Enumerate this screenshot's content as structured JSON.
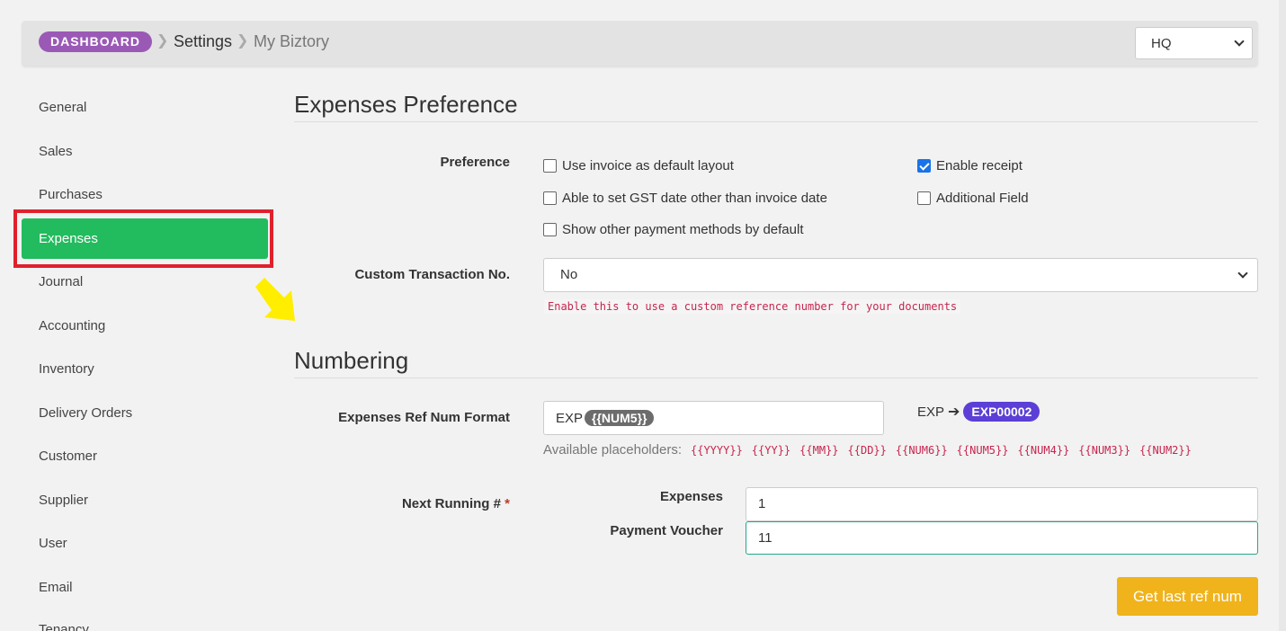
{
  "breadcrumb": {
    "dashboard": "DASHBOARD",
    "settings": "Settings",
    "company": "My Biztory"
  },
  "branch_select": {
    "value": "HQ"
  },
  "sidebar": {
    "items": [
      {
        "label": "General"
      },
      {
        "label": "Sales"
      },
      {
        "label": "Purchases"
      },
      {
        "label": "Expenses",
        "active": true
      },
      {
        "label": "Journal"
      },
      {
        "label": "Accounting"
      },
      {
        "label": "Inventory"
      },
      {
        "label": "Delivery Orders"
      },
      {
        "label": "Customer"
      },
      {
        "label": "Supplier"
      },
      {
        "label": "User"
      },
      {
        "label": "Email"
      },
      {
        "label": "Tenancy"
      }
    ]
  },
  "expenses_preference": {
    "title": "Expenses Preference",
    "preference_label": "Preference",
    "options": [
      {
        "label": "Use invoice as default layout",
        "checked": false
      },
      {
        "label": "Enable receipt",
        "checked": true
      },
      {
        "label": "Able to set GST date other than invoice date",
        "checked": false
      },
      {
        "label": "Additional Field",
        "checked": false
      },
      {
        "label": "Show other payment methods by default",
        "checked": false
      }
    ],
    "custom_txn_label": "Custom Transaction No.",
    "custom_txn_value": "No",
    "custom_txn_hint": "Enable this to use a custom reference number for your documents"
  },
  "numbering": {
    "title": "Numbering",
    "ref_format_label": "Expenses Ref Num Format",
    "ref_prefix": "EXP",
    "ref_placeholder_token": "{{NUM5}}",
    "preview_prefix": "EXP",
    "preview_arrow": "➔",
    "preview_result": "EXP00002",
    "available_label": "Available placeholders:",
    "placeholders": [
      "{{YYYY}}",
      "{{YY}}",
      "{{MM}}",
      "{{DD}}",
      "{{NUM6}}",
      "{{NUM5}}",
      "{{NUM4}}",
      "{{NUM3}}",
      "{{NUM2}}"
    ],
    "next_running_label": "Next Running #",
    "required_mark": "*",
    "expenses_label": "Expenses",
    "expenses_value": "1",
    "payment_voucher_label": "Payment Voucher",
    "payment_voucher_value": "11",
    "get_last_button": "Get last ref num"
  },
  "colors": {
    "active_sidebar": "#22bb5e",
    "highlight": "#e0202c",
    "annotation_arrow": "#ffee00",
    "dashboard_pill": "#9b59b6",
    "preview_pill": "#5b3fd6",
    "button": "#f0b31b"
  }
}
